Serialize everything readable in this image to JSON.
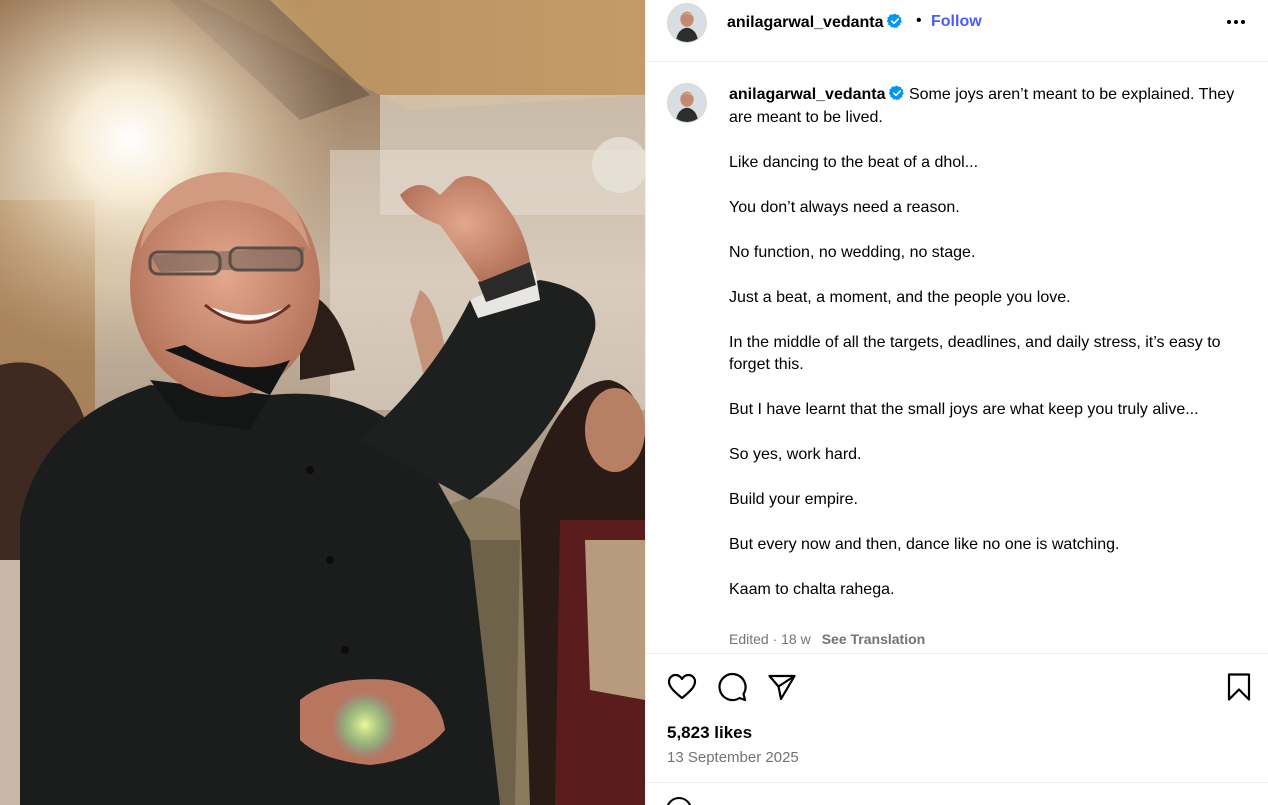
{
  "photo": {
    "alt": "Man in black bandhgala dancing at a celebration"
  },
  "header": {
    "username": "anilagarwal_vedanta",
    "separator": "•",
    "follow_label": "Follow",
    "more_icon": "more-options-icon"
  },
  "caption": {
    "username": "anilagarwal_vedanta",
    "paragraphs": [
      "Some joys aren’t meant to be explained. They are meant to be lived.",
      "Like dancing to the beat of a dhol...",
      "You don’t always need a reason.",
      "No function, no wedding, no stage.",
      "Just a beat, a moment, and the people you love.",
      "In the middle of all the targets, deadlines, and daily stress, it’s easy to forget this.",
      "But I have learnt that the small joys are what keep you truly alive...",
      "So yes, work hard.",
      "Build your empire.",
      "But every now and then, dance like no one is watching.",
      "Kaam to chalta rahega."
    ],
    "edited": "Edited · 18 w",
    "see_translation": "See Translation"
  },
  "actions": {
    "icons": [
      "heart-icon",
      "comment-icon",
      "share-icon",
      "bookmark-icon"
    ],
    "likes": "5,823 likes",
    "date": "13 September 2025"
  },
  "colors": {
    "link": "#4a5df9",
    "verified": "#0095f6",
    "muted": "#737373",
    "divider": "#efefef"
  }
}
